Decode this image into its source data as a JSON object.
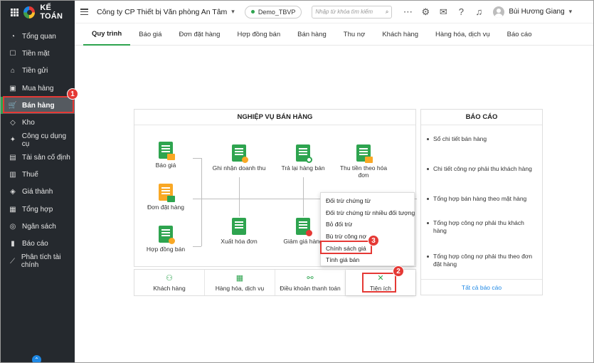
{
  "app": {
    "logo_text": "KẾ TOÁN"
  },
  "sidebar": {
    "items": [
      {
        "label": "Tổng quan",
        "icon": "gauge-icon",
        "glyph": "◔"
      },
      {
        "label": "Tiền mặt",
        "icon": "cash-icon",
        "glyph": "☐"
      },
      {
        "label": "Tiền gửi",
        "icon": "bank-icon",
        "glyph": "⌂"
      },
      {
        "label": "Mua hàng",
        "icon": "purchase-icon",
        "glyph": "▣"
      },
      {
        "label": "Bán hàng",
        "icon": "cart-icon",
        "glyph": "🛒"
      },
      {
        "label": "Kho",
        "icon": "warehouse-icon",
        "glyph": "◇"
      },
      {
        "label": "Công cụ dụng cụ",
        "icon": "tools-icon",
        "glyph": "✦"
      },
      {
        "label": "Tài sản cố định",
        "icon": "asset-icon",
        "glyph": "▤"
      },
      {
        "label": "Thuế",
        "icon": "tax-icon",
        "glyph": "▥"
      },
      {
        "label": "Giá thành",
        "icon": "price-tag-icon",
        "glyph": "◈"
      },
      {
        "label": "Tổng hợp",
        "icon": "summary-icon",
        "glyph": "▦"
      },
      {
        "label": "Ngân sách",
        "icon": "budget-icon",
        "glyph": "◎"
      },
      {
        "label": "Báo cáo",
        "icon": "report-icon",
        "glyph": "▮"
      },
      {
        "label": "Phân tích tài chính",
        "icon": "analytics-icon",
        "glyph": "⟋"
      }
    ],
    "active_index": 4,
    "badge_1": "1"
  },
  "header": {
    "company": "Công ty CP Thiết bị Văn phòng An Tâm",
    "database": "Demo_TBVP",
    "search_placeholder": "Nhập từ khóa tìm kiếm",
    "user_name": "Bùi Hương Giang"
  },
  "tabs": [
    "Quy trình",
    "Báo giá",
    "Đơn đặt hàng",
    "Hợp đồng bán",
    "Bán hàng",
    "Thu nợ",
    "Khách hàng",
    "Hàng hóa, dịch vụ",
    "Báo cáo"
  ],
  "process": {
    "title": "NGHIỆP VỤ BÁN HÀNG",
    "nodes": {
      "bao_gia": "Báo giá",
      "don_dat_hang": "Đơn đặt hàng",
      "hop_dong_ban": "Hợp đồng bán",
      "ghi_nhan_doanh_thu": "Ghi nhận doanh thu",
      "xuat_hoa_don": "Xuất hóa đơn",
      "tra_lai_hang_ban": "Trả lại hàng bán",
      "giam_gia_hang": "Giảm giá hàng",
      "thu_tien": "Thu tiền theo hóa đơn"
    }
  },
  "context_menu": {
    "items": [
      "Đối trừ chứng từ",
      "Đối trừ chứng từ nhiều đối tượng",
      "Bỏ đối trừ",
      "Bù trừ công nợ",
      "Chính sách giá",
      "Tính giá bán"
    ],
    "badge_3": "3"
  },
  "bottom_bar": {
    "items": [
      "Khách hàng",
      "Hàng hóa, dịch vụ",
      "Điều khoản thanh toán",
      "Tiện ích"
    ],
    "badge_2": "2"
  },
  "reports": {
    "title": "BÁO CÁO",
    "items": [
      "Sổ chi tiết bán hàng",
      "Chi tiết công nợ phải thu khách hàng",
      "Tổng hợp bán hàng theo mặt hàng",
      "Tổng hợp công nợ phải thu khách hàng",
      "Tổng hợp công nợ phải thu theo đơn đặt hàng"
    ],
    "all_link": "Tất cả báo cáo"
  },
  "colors": {
    "accent": "#2ea44f",
    "highlight": "#e53935",
    "sidebar": "#25292e",
    "link": "#1e88e5"
  }
}
